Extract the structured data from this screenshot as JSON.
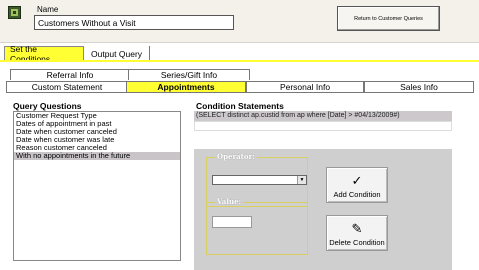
{
  "header": {
    "name_label": "Name",
    "name_value": "Customers Without a Visit",
    "return_button": "Return to Customer Queries"
  },
  "top_tabs": {
    "set_conditions": "Set the Conditions",
    "output_query": "Output Query"
  },
  "tabs": {
    "row1": [
      "Referral Info",
      "Series/Gift Info"
    ],
    "row2": [
      "Custom Statement",
      "Appointments",
      "Personal Info",
      "Sales Info"
    ],
    "active": "Appointments"
  },
  "query_questions": {
    "title": "Query Questions",
    "items": [
      "Customer Request Type",
      "Dates of appointment in past",
      "Date when customer canceled",
      "Date when customer was late",
      "Reason customer canceled",
      "With no appointments in the future"
    ],
    "selected_index": 5
  },
  "condition_statements": {
    "title": "Condition Statements",
    "statement": "(SELECT distinct ap.custid from ap where  [Date] > #04/13/2009#)"
  },
  "panel": {
    "operator_label": "Operator:",
    "value_label": "Value:",
    "add_button": "Add Condition",
    "delete_button": "Delete Condition",
    "add_icon": "check-pen-icon",
    "delete_icon": "eraser-icon"
  },
  "colors": {
    "accent_yellow": "#ffff33",
    "panel_gray": "#cfcfcf",
    "selection_gray": "#c8c4c8"
  }
}
